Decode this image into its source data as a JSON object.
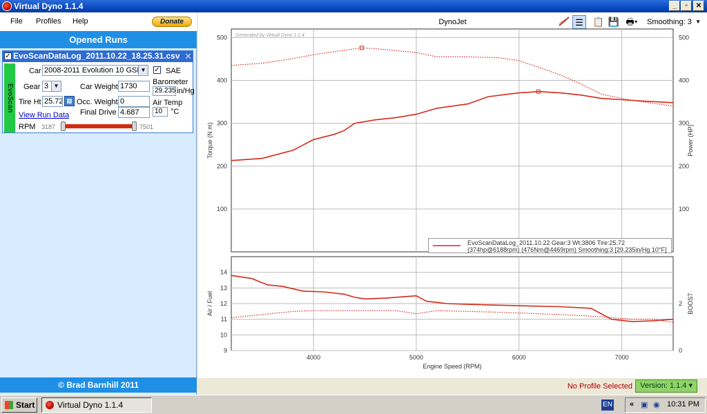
{
  "window": {
    "title": "Virtual Dyno 1.1.4"
  },
  "menu": {
    "file": "File",
    "profiles": "Profiles",
    "help": "Help",
    "donate": "Donate"
  },
  "sidebar": {
    "header": "Opened Runs",
    "run": {
      "title": "EvoScanDataLog_2011.10.22_18.25.31.csv",
      "source_tab": "EvoScan",
      "car_label": "Car",
      "car_value": "2008-2011 Evolution 10 GSR",
      "sae_label": "SAE",
      "gear_label": "Gear",
      "gear_value": "3",
      "car_weight_label": "Car Weight",
      "car_weight_value": "1730",
      "barometer_label": "Barometer",
      "barometer_value": "29.235",
      "barometer_unit": "in/Hg",
      "tire_ht_label": "Tire Ht",
      "tire_ht_value": "25.72",
      "occ_weight_label": "Occ. Weight",
      "occ_weight_value": "0",
      "air_temp_label": "Air Temp",
      "air_temp_value": "10",
      "air_temp_unit": "°C",
      "view_run_data": "View Run Data",
      "final_drive_label": "Final Drive",
      "final_drive_value": "4.687",
      "rpm_label": "RPM",
      "rpm_min": "3187",
      "rpm_max": "7501"
    },
    "copyright": "© Brad Barnhill 2011"
  },
  "chart_pane": {
    "title": "DynoJet",
    "smoothing_label": "Smoothing: 3",
    "watermark": "Generated by Virtual Dyno 1.1.4",
    "legend_line1": "EvoScanDataLog_2011.10.22 Gear:3 Wt:3806 Tire:25.72",
    "legend_line2": "(374hp@6188rpm) (476Nm@4469rpm) Smoothing:3 [29.235in/Hg 10°F]"
  },
  "chart_data": [
    {
      "type": "line",
      "xlabel": "Engine Speed (RPM)",
      "ylabel": "Torque (N m)",
      "y2label": "Power (HP)",
      "xlim": [
        3200,
        7500
      ],
      "ylim": [
        0,
        520
      ],
      "yticks": [
        100,
        200,
        300,
        400,
        500
      ],
      "grid": true,
      "legend_position": "bottom-right",
      "series": [
        {
          "name": "Power (HP)",
          "style": "solid",
          "color": "#d42a1a",
          "x": [
            3200,
            3500,
            3800,
            4000,
            4200,
            4300,
            4400,
            4600,
            4800,
            5000,
            5200,
            5500,
            5700,
            6000,
            6188,
            6400,
            6600,
            6800,
            7000,
            7200,
            7500
          ],
          "y": [
            213,
            218,
            237,
            262,
            274,
            283,
            300,
            308,
            313,
            321,
            335,
            345,
            362,
            371,
            374,
            371,
            366,
            358,
            355,
            352,
            348
          ]
        },
        {
          "name": "Torque (N m)",
          "style": "dotted",
          "color": "#d42a1a",
          "x": [
            3200,
            3500,
            3800,
            4000,
            4200,
            4469,
            4700,
            5000,
            5200,
            5500,
            5800,
            6000,
            6200,
            6400,
            6600,
            6800,
            7000,
            7200,
            7500
          ],
          "y": [
            435,
            440,
            451,
            460,
            467,
            476,
            472,
            465,
            455,
            455,
            453,
            446,
            430,
            413,
            392,
            368,
            358,
            350,
            340
          ]
        }
      ],
      "markers": [
        {
          "x": 4469,
          "y": 476
        },
        {
          "x": 6188,
          "y": 374
        }
      ]
    },
    {
      "type": "line",
      "xlabel": "Engine Speed (RPM)",
      "ylabel": "Air / Fuel",
      "y2label": "BOOST",
      "xlim": [
        3200,
        7500
      ],
      "ylim": [
        9,
        15
      ],
      "yticks": [
        9,
        10,
        11,
        12,
        13,
        14
      ],
      "xticks": [
        4000,
        5000,
        6000,
        7000
      ],
      "grid": true,
      "series": [
        {
          "name": "Air / Fuel",
          "style": "solid",
          "color": "#d42a1a",
          "x": [
            3200,
            3400,
            3550,
            3700,
            3900,
            4100,
            4300,
            4400,
            4500,
            4700,
            4900,
            5000,
            5100,
            5300,
            5500,
            5800,
            6100,
            6400,
            6700,
            6900,
            7100,
            7300,
            7500
          ],
          "y": [
            13.8,
            13.6,
            13.2,
            13.1,
            12.8,
            12.75,
            12.6,
            12.4,
            12.3,
            12.35,
            12.45,
            12.5,
            12.15,
            12.0,
            11.95,
            11.9,
            11.85,
            11.8,
            11.7,
            11.0,
            10.85,
            10.9,
            11.0
          ]
        },
        {
          "name": "BOOST",
          "style": "dotted",
          "color": "#d42a1a",
          "x": [
            3200,
            3500,
            3800,
            4000,
            4400,
            4800,
            5000,
            5200,
            5500,
            5800,
            6000,
            6400,
            6700,
            6900,
            7100,
            7300,
            7500
          ],
          "y": [
            11.1,
            11.3,
            11.5,
            11.55,
            11.55,
            11.55,
            11.35,
            11.55,
            11.5,
            11.45,
            11.4,
            11.3,
            11.2,
            11.1,
            11.0,
            11.0,
            10.8
          ]
        }
      ]
    }
  ],
  "status": {
    "no_profile": "No Profile Selected",
    "version": "Version: 1.1.4 ▾"
  },
  "taskbar": {
    "start": "Start",
    "task_item": "Virtual Dyno 1.1.4",
    "lang": "EN",
    "clock": "10:31 PM",
    "tray_arrow": "«"
  }
}
